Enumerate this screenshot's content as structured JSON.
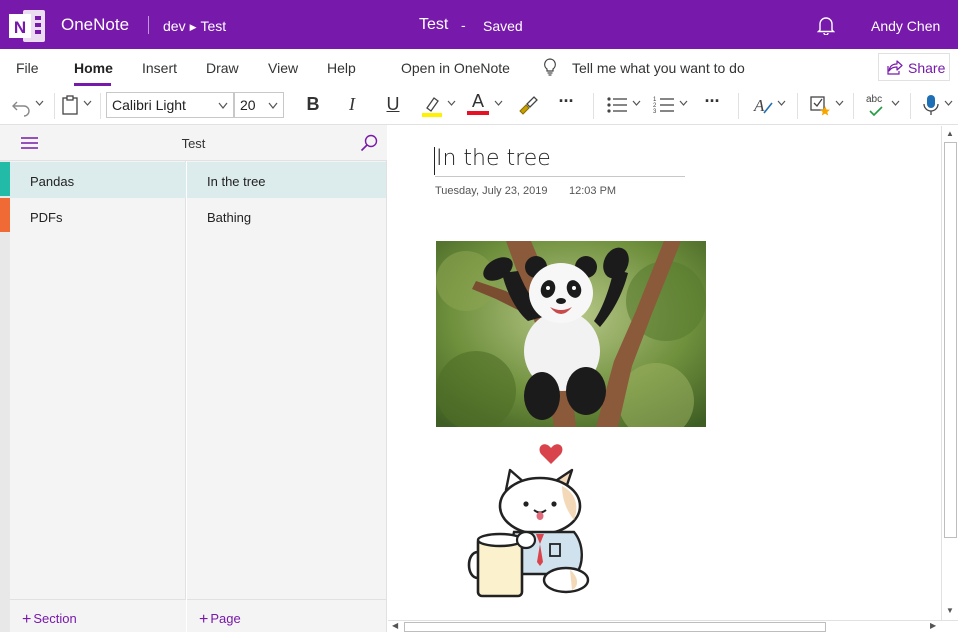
{
  "titlebar": {
    "app_name": "OneNote",
    "breadcrumb": {
      "notebook": "dev",
      "section": "Test"
    },
    "doc_title": "Test",
    "doc_dash": "-",
    "doc_status": "Saved",
    "user_name": "Andy Chen",
    "accent_color": "#7719aa"
  },
  "menu": {
    "items": [
      "File",
      "Home",
      "Insert",
      "Draw",
      "View",
      "Help",
      "Open in OneNote"
    ],
    "active": "Home",
    "tell_me": "Tell me what you want to do",
    "share_label": "Share"
  },
  "ribbon": {
    "font_name": "Calibri Light",
    "font_size": "20",
    "bold": "B",
    "italic": "I",
    "underline": "U",
    "font_color": "A",
    "more": "···",
    "spelling": "abc",
    "highlight_color": "#fff100",
    "font_color_value": "#e81123"
  },
  "nav": {
    "notebook_title": "Test",
    "sections": [
      {
        "label": "Pandas",
        "color": "#22bba8",
        "selected": true
      },
      {
        "label": "PDFs",
        "color": "#f06a35",
        "selected": false
      }
    ],
    "pages": [
      {
        "label": "In the tree",
        "selected": true
      },
      {
        "label": "Bathing",
        "selected": false
      }
    ],
    "add_section": "Section",
    "add_page": "Page"
  },
  "page": {
    "title": "In the tree",
    "date": "Tuesday, July 23, 2019",
    "time": "12:03 PM"
  }
}
